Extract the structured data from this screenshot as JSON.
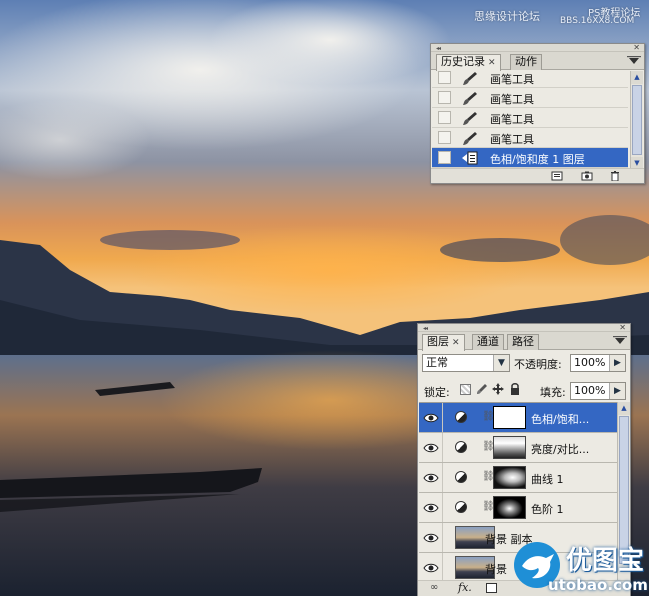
{
  "watermark": {
    "line1": "思缘设计论坛",
    "line2": "PS教程论坛",
    "line3": "BBS.16XX8.COM"
  },
  "history_panel": {
    "tabs": [
      {
        "label": "历史记录",
        "active": true
      },
      {
        "label": "动作",
        "active": false
      }
    ],
    "items": [
      {
        "label": "画笔工具",
        "icon": "brush-icon",
        "selected": false
      },
      {
        "label": "画笔工具",
        "icon": "brush-icon",
        "selected": false
      },
      {
        "label": "画笔工具",
        "icon": "brush-icon",
        "selected": false
      },
      {
        "label": "画笔工具",
        "icon": "brush-icon",
        "selected": false
      },
      {
        "label": "色相/饱和度 1 图层",
        "icon": "adjustment-layer-icon",
        "selected": true
      }
    ],
    "bottom_icons": [
      "new-document-icon",
      "snapshot-icon",
      "trash-icon"
    ]
  },
  "layers_panel": {
    "tabs": [
      {
        "label": "图层",
        "active": true
      },
      {
        "label": "通道",
        "active": false
      },
      {
        "label": "路径",
        "active": false
      }
    ],
    "blend_mode": "正常",
    "opacity_label": "不透明度:",
    "opacity_value": "100%",
    "lock_label": "锁定:",
    "fill_label": "填充:",
    "fill_value": "100%",
    "layers": [
      {
        "name": "色相/饱和...",
        "type": "adjustment",
        "selected": true
      },
      {
        "name": "亮度/对比...",
        "type": "adjustment",
        "selected": false
      },
      {
        "name": "曲线 1",
        "type": "adjustment",
        "selected": false
      },
      {
        "name": "色阶 1",
        "type": "adjustment",
        "selected": false
      },
      {
        "name": "背景 副本",
        "type": "image",
        "selected": false
      },
      {
        "name": "背景",
        "type": "image",
        "selected": false
      }
    ]
  },
  "brand": {
    "name": "优图宝",
    "url": "utobao.com"
  }
}
